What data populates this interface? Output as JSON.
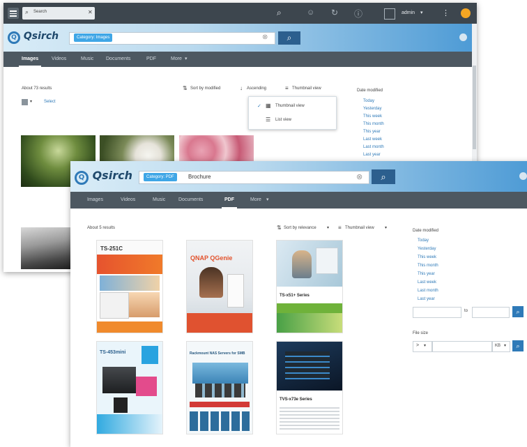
{
  "back_window": {
    "topbar": {
      "tab_label": "Search",
      "user_label": "admin"
    },
    "logo_text": "Qsirch",
    "search_chip": "Category: Images",
    "nav_tabs": [
      "Images",
      "Videos",
      "Music",
      "Documents",
      "PDF",
      "More"
    ],
    "active_tab": "Images",
    "results_count": "About 73 results",
    "select_label": "Select",
    "sort_label": "Sort by modified",
    "order_label": "Ascending",
    "view_label": "Thumbnail view",
    "view_options": [
      "Thumbnail view",
      "List view"
    ],
    "sidebar_title": "Date modified",
    "sidebar_items": [
      "Today",
      "Yesterday",
      "This week",
      "This month",
      "This year",
      "Last week",
      "Last month",
      "Last year"
    ]
  },
  "front_window": {
    "logo_text": "Qsirch",
    "search_chip": "Category: PDF",
    "search_query": "Brochure",
    "nav_tabs": [
      "Images",
      "Videos",
      "Music",
      "Documents",
      "PDF",
      "More"
    ],
    "active_tab": "PDF",
    "results_count": "About 5 results",
    "sort_label": "Sort by relevance",
    "view_label": "Thumbnail view",
    "sidebar_title": "Date modified",
    "sidebar_items": [
      "Today",
      "Yesterday",
      "This week",
      "This month",
      "This year",
      "Last week",
      "Last month",
      "Last year"
    ],
    "date_to_label": "to",
    "filesize_title": "File size",
    "filesize_op": ">",
    "filesize_unit": "KB",
    "thumbnails": [
      {
        "title": "TS-251C"
      },
      {
        "title": "QNAP QGenie"
      },
      {
        "title": "TS-x51+ Series"
      },
      {
        "title": "TS-453mini"
      },
      {
        "title": "Rackmount NAS Servers for SMB"
      },
      {
        "title": "TVS-x73e Series"
      }
    ]
  },
  "colors": {
    "accent": "#2f7ab8",
    "chip": "#3fa6e6",
    "search_button": "#2c5f8e",
    "nav_bar": "#4d5861",
    "top_bar": "#3d464e",
    "notification": "#f5a623"
  }
}
